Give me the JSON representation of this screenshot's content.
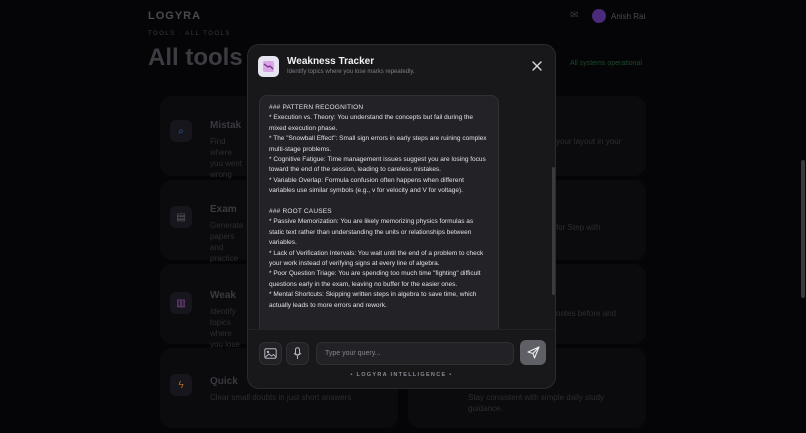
{
  "background": {
    "logo": "LOGYRA",
    "user_name": "Anish Rai",
    "breadcrumb": "TOOLS · ALL TOOLS",
    "page_title": "All tools b",
    "status_text": "All systems operational",
    "cards": [
      {
        "icon": "magnifier-icon",
        "title": "Mistak",
        "desc": "Find where you went wrong without a lecture"
      },
      {
        "icon": "doc-icon",
        "title": "Exam",
        "desc": "Generate papers and practice sets"
      },
      {
        "icon": "chart-icon",
        "title": "Weak",
        "desc": "Identify topics where you lose marks repeatedly"
      },
      {
        "icon": "bolt-icon",
        "title": "Quick",
        "desc": "Clear small doubts in just short answers"
      }
    ],
    "right_texts": [
      "your layout in your",
      "for Step with",
      "notes before and",
      "Stay consistent with simple daily study guidance."
    ]
  },
  "modal": {
    "title": "Weakness Tracker",
    "subtitle": "Identify topics where you lose marks repeatedly.",
    "close_label": "×",
    "message": [
      "### PATTERN RECOGNITION",
      "*   Execution vs. Theory: You understand the concepts but fail during the mixed execution phase.",
      "*   The \"Snowball Effect\": Small sign errors in early steps are ruining complex multi-stage problems.",
      "*   Cognitive Fatigue: Time management issues suggest you are losing focus toward the end of the session, leading to careless mistakes.",
      "*   Variable Overlap: Formula confusion often happens when different variables use similar symbols (e.g., v for velocity and V for voltage).",
      "",
      "### ROOT CAUSES",
      "*   Passive Memorization: You are likely memorizing physics formulas as static text rather than understanding the units or relationships between variables.",
      "*   Lack of Verification Intervals: You wait until the end of a problem to check your work instead of verifying signs at every line of algebra.",
      "*   Poor Question Triage: You are spending too much time \"fighting\" difficult questions early in the exam, leaving no buffer for the easier ones.",
      "*   Mental Shortcuts: Skipping written steps in algebra to save time, which actually leads to more errors and rework."
    ],
    "input_placeholder": "Type your query...",
    "footer": "• LOGYRA INTELLIGENCE •"
  }
}
